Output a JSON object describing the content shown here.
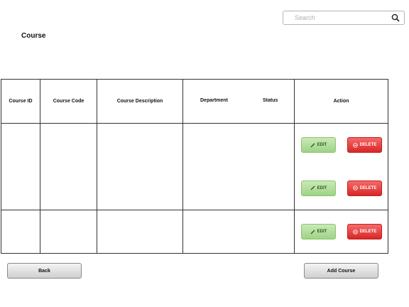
{
  "search": {
    "placeholder": "Search"
  },
  "page": {
    "title": "Course"
  },
  "table": {
    "headers": {
      "course_id": "Course ID",
      "course_code": "Course Code",
      "course_description": "Course Description",
      "department": "Department",
      "status": "Status",
      "action": "Action"
    }
  },
  "actions": {
    "edit_label": "EDIT",
    "delete_label": "DELETE"
  },
  "footer": {
    "back_label": "Back",
    "add_course_label": "Add Course"
  },
  "colors": {
    "edit": "#9fd385",
    "delete": "#d92626",
    "button": "#cfcfcf"
  }
}
